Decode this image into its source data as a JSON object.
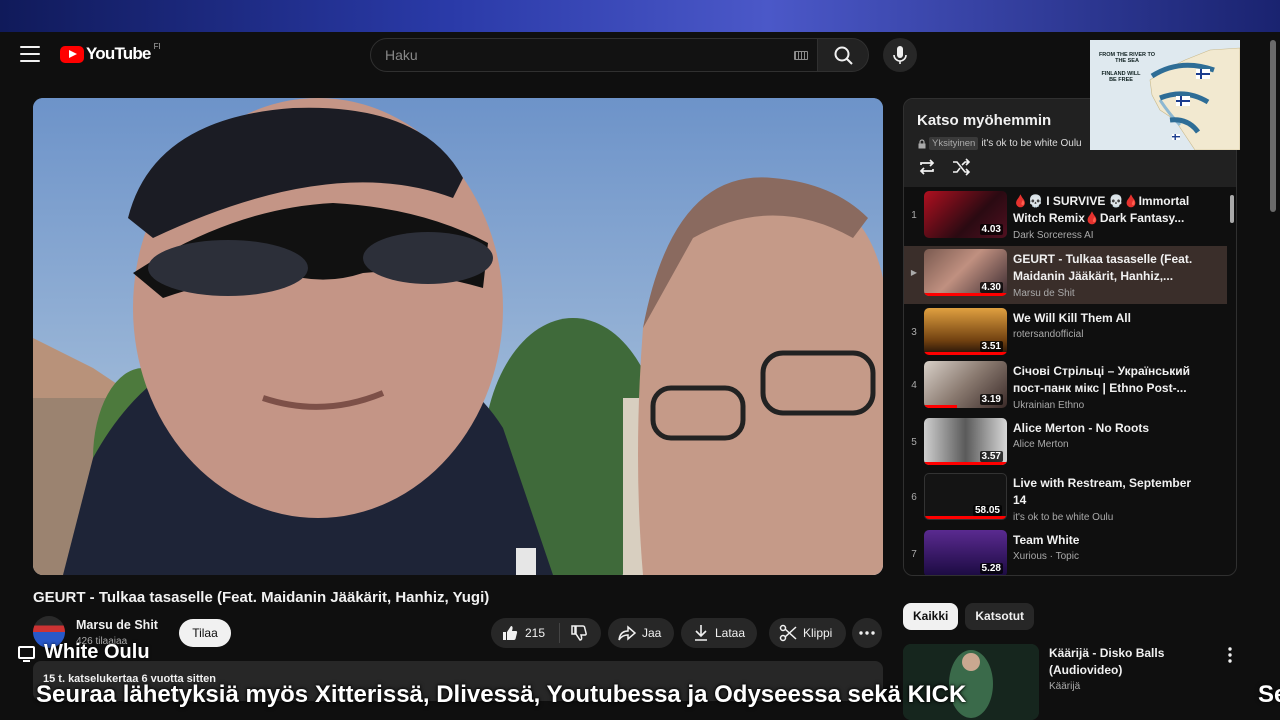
{
  "header": {
    "logo_text": "YouTube",
    "country_code": "FI",
    "search_placeholder": "Haku"
  },
  "map_overlay": {
    "line1": "FROM THE RIVER TO THE SEA",
    "line2": "FINLAND WILL BE FREE"
  },
  "video": {
    "title": "GEURT - Tulkaa tasaselle (Feat. Maidanin Jääkärit, Hanhiz, Yugi)",
    "channel": "Marsu de Shit",
    "subscribers": "426 tilaajaa",
    "subscribe_label": "Tilaa",
    "likes": "215",
    "share_label": "Jaa",
    "download_label": "Lataa",
    "clip_label": "Klippi",
    "views_date": "15 t. katselukertaa  6 vuotta sitten"
  },
  "stream_overlay": {
    "channel_name": "White Oulu",
    "ticker": "Seuraa lähetyksiä myös Xitterissä, Dlivessä, Youtubessa ja Odyseessa sekä KICK",
    "ticker_tail": "Se"
  },
  "playlist": {
    "title": "Katso myöhemmin",
    "privacy": "Yksityinen",
    "owner": "it's ok to be white Oulu",
    "items": [
      {
        "index": "1",
        "title": "🩸💀 I SURVIVE 💀🩸Immortal Witch Remix🩸Dark Fantasy...",
        "channel": "Dark Sorceress AI",
        "duration": "4.03"
      },
      {
        "index": "▶",
        "title": "GEURT - Tulkaa tasaselle (Feat. Maidanin Jääkärit, Hanhiz,...",
        "channel": "Marsu de Shit",
        "duration": "4.30"
      },
      {
        "index": "3",
        "title": "We Will Kill Them All",
        "channel": "rotersandofficial",
        "duration": "3.51"
      },
      {
        "index": "4",
        "title": "Січові Стрільці – Український пост-панк мікс | Ethno Post-...",
        "channel": "Ukrainian Ethno",
        "duration": "3.19"
      },
      {
        "index": "5",
        "title": "Alice Merton - No Roots",
        "channel": "Alice Merton",
        "duration": "3.57"
      },
      {
        "index": "6",
        "title": "Live with Restream, September 14",
        "channel": "it's ok to be white Oulu",
        "duration": "58.05"
      },
      {
        "index": "7",
        "title": "Team White",
        "channel": "Xurious · Topic",
        "duration": "5.28"
      }
    ]
  },
  "chips": {
    "all": "Kaikki",
    "watched": "Katsotut"
  },
  "recommendation": {
    "title": "Käärijä - Disko Balls (Audiovideo)",
    "channel": "Käärijä"
  }
}
